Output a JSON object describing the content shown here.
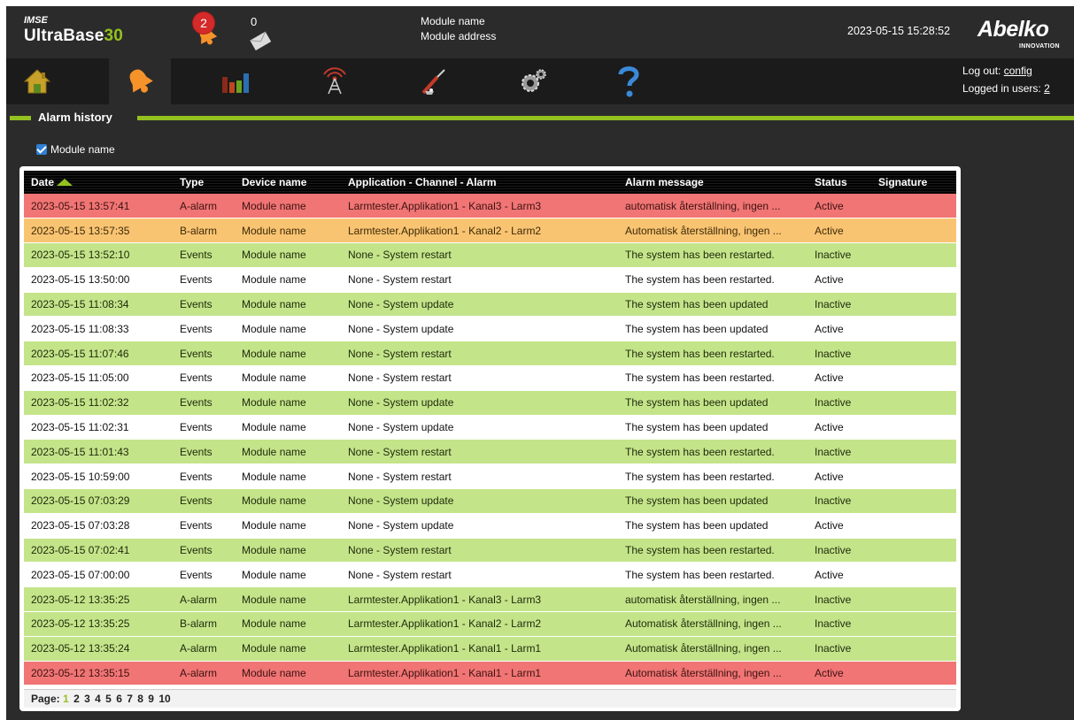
{
  "header": {
    "brand_sub": "IMSE",
    "brand_main": "UltraBase",
    "brand_num": "30",
    "alarm_count": "2",
    "message_count": "0",
    "module_name": "Module name",
    "module_address": "Module address",
    "datetime": "2023-05-15 15:28:52",
    "logo": "Abelko",
    "logo_sub": "INNOVATION"
  },
  "nav": {
    "items": [
      "home-icon",
      "bell-icon",
      "chart-icon",
      "antenna-icon",
      "tools-icon",
      "gears-icon",
      "help-icon"
    ],
    "active": "bell-icon",
    "logout_label": "Log out: ",
    "logout_user": "config",
    "logged_in_label": "Logged in users: ",
    "logged_in_count": "2"
  },
  "section": {
    "title": "Alarm history"
  },
  "filter": {
    "label": "Module name",
    "checked": true
  },
  "table": {
    "columns": [
      "Date",
      "Type",
      "Device name",
      "Application - Channel - Alarm",
      "Alarm message",
      "Status",
      "Signature"
    ],
    "rows": [
      {
        "date": "2023-05-15 13:57:41",
        "type": "A-alarm",
        "device": "Module name",
        "app": "Larmtester.Applikation1 - Kanal3 - Larm3",
        "message": "automatisk återställning, ingen ...",
        "status": "Active",
        "signature": "",
        "color": "red"
      },
      {
        "date": "2023-05-15 13:57:35",
        "type": "B-alarm",
        "device": "Module name",
        "app": "Larmtester.Applikation1 - Kanal2 - Larm2",
        "message": "Automatisk återställning, ingen ...",
        "status": "Active",
        "signature": "",
        "color": "orange"
      },
      {
        "date": "2023-05-15 13:52:10",
        "type": "Events",
        "device": "Module name",
        "app": "None - System restart",
        "message": "The system has been restarted.",
        "status": "Inactive",
        "signature": "",
        "color": "green"
      },
      {
        "date": "2023-05-15 13:50:00",
        "type": "Events",
        "device": "Module name",
        "app": "None - System restart",
        "message": "The system has been restarted.",
        "status": "Active",
        "signature": "",
        "color": "white"
      },
      {
        "date": "2023-05-15 11:08:34",
        "type": "Events",
        "device": "Module name",
        "app": "None - System update",
        "message": "The system has been updated",
        "status": "Inactive",
        "signature": "",
        "color": "green"
      },
      {
        "date": "2023-05-15 11:08:33",
        "type": "Events",
        "device": "Module name",
        "app": "None - System update",
        "message": "The system has been updated",
        "status": "Active",
        "signature": "",
        "color": "white"
      },
      {
        "date": "2023-05-15 11:07:46",
        "type": "Events",
        "device": "Module name",
        "app": "None - System restart",
        "message": "The system has been restarted.",
        "status": "Inactive",
        "signature": "",
        "color": "green"
      },
      {
        "date": "2023-05-15 11:05:00",
        "type": "Events",
        "device": "Module name",
        "app": "None - System restart",
        "message": "The system has been restarted.",
        "status": "Active",
        "signature": "",
        "color": "white"
      },
      {
        "date": "2023-05-15 11:02:32",
        "type": "Events",
        "device": "Module name",
        "app": "None - System update",
        "message": "The system has been updated",
        "status": "Inactive",
        "signature": "",
        "color": "green"
      },
      {
        "date": "2023-05-15 11:02:31",
        "type": "Events",
        "device": "Module name",
        "app": "None - System update",
        "message": "The system has been updated",
        "status": "Active",
        "signature": "",
        "color": "white"
      },
      {
        "date": "2023-05-15 11:01:43",
        "type": "Events",
        "device": "Module name",
        "app": "None - System restart",
        "message": "The system has been restarted.",
        "status": "Inactive",
        "signature": "",
        "color": "green"
      },
      {
        "date": "2023-05-15 10:59:00",
        "type": "Events",
        "device": "Module name",
        "app": "None - System restart",
        "message": "The system has been restarted.",
        "status": "Active",
        "signature": "",
        "color": "white"
      },
      {
        "date": "2023-05-15 07:03:29",
        "type": "Events",
        "device": "Module name",
        "app": "None - System update",
        "message": "The system has been updated",
        "status": "Inactive",
        "signature": "",
        "color": "green"
      },
      {
        "date": "2023-05-15 07:03:28",
        "type": "Events",
        "device": "Module name",
        "app": "None - System update",
        "message": "The system has been updated",
        "status": "Active",
        "signature": "",
        "color": "white"
      },
      {
        "date": "2023-05-15 07:02:41",
        "type": "Events",
        "device": "Module name",
        "app": "None - System restart",
        "message": "The system has been restarted.",
        "status": "Inactive",
        "signature": "",
        "color": "green"
      },
      {
        "date": "2023-05-15 07:00:00",
        "type": "Events",
        "device": "Module name",
        "app": "None - System restart",
        "message": "The system has been restarted.",
        "status": "Active",
        "signature": "",
        "color": "white"
      },
      {
        "date": "2023-05-12 13:35:25",
        "type": "A-alarm",
        "device": "Module name",
        "app": "Larmtester.Applikation1 - Kanal3 - Larm3",
        "message": "automatisk återställning, ingen ...",
        "status": "Inactive",
        "signature": "",
        "color": "green"
      },
      {
        "date": "2023-05-12 13:35:25",
        "type": "B-alarm",
        "device": "Module name",
        "app": "Larmtester.Applikation1 - Kanal2 - Larm2",
        "message": "Automatisk återställning, ingen ...",
        "status": "Inactive",
        "signature": "",
        "color": "green"
      },
      {
        "date": "2023-05-12 13:35:24",
        "type": "A-alarm",
        "device": "Module name",
        "app": "Larmtester.Applikation1 - Kanal1 - Larm1",
        "message": "Automatisk återställning, ingen ...",
        "status": "Inactive",
        "signature": "",
        "color": "green"
      },
      {
        "date": "2023-05-12 13:35:15",
        "type": "A-alarm",
        "device": "Module name",
        "app": "Larmtester.Applikation1 - Kanal1 - Larm1",
        "message": "Automatisk återställning, ingen ...",
        "status": "Active",
        "signature": "",
        "color": "red"
      }
    ]
  },
  "pager": {
    "label": "Page:",
    "pages": [
      "1",
      "2",
      "3",
      "4",
      "5",
      "6",
      "7",
      "8",
      "9",
      "10"
    ],
    "current": "1"
  },
  "colors": {
    "accent": "#94c11f",
    "alarm_a": "#f07574",
    "alarm_b": "#f9c472",
    "inactive": "#c4e48a",
    "badge": "#d42a2a"
  }
}
